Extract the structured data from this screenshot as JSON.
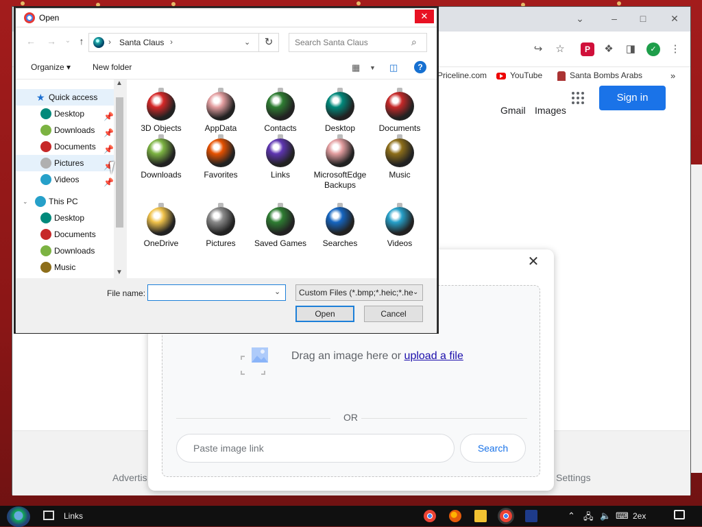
{
  "browser": {
    "bookmarks": [
      "Priceline.com",
      "YouTube",
      "Santa Bombs Arabs"
    ],
    "header_links": [
      "Gmail",
      "Images"
    ],
    "signin_label": "Sign in",
    "footer": {
      "left": "Advertis",
      "right": "Settings"
    }
  },
  "image_search": {
    "drop_text": "Drag an image here or",
    "upload_link": "upload a file",
    "or_label": "OR",
    "paste_placeholder": "Paste image link",
    "search_label": "Search"
  },
  "open_dialog": {
    "title": "Open",
    "breadcrumb": "Santa Claus",
    "search_placeholder": "Search Santa Claus",
    "organize_label": "Organize ▾",
    "new_folder_label": "New folder",
    "nav_pane": {
      "quick_access": "Quick access",
      "quick_items": [
        "Desktop",
        "Downloads",
        "Documents",
        "Pictures",
        "Videos"
      ],
      "this_pc": "This PC",
      "pc_items": [
        "Desktop",
        "Documents",
        "Downloads",
        "Music"
      ]
    },
    "files": [
      {
        "name": "3D Objects",
        "color": "#d62828"
      },
      {
        "name": "AppData",
        "color": "#e39ea0"
      },
      {
        "name": "Contacts",
        "color": "#2e7d32"
      },
      {
        "name": "Desktop",
        "color": "#00897b"
      },
      {
        "name": "Documents",
        "color": "#c62828"
      },
      {
        "name": "Downloads",
        "color": "#7cb342"
      },
      {
        "name": "Favorites",
        "color": "#e65100"
      },
      {
        "name": "Links",
        "color": "#5e35b1"
      },
      {
        "name": "MicrosoftEdgeBackups",
        "color": "#e39ea0"
      },
      {
        "name": "Music",
        "color": "#8d6e1a"
      },
      {
        "name": "OneDrive",
        "color": "#f0c24a"
      },
      {
        "name": "Pictures",
        "color": "#8a8a8a"
      },
      {
        "name": "Saved Games",
        "color": "#2e7d32"
      },
      {
        "name": "Searches",
        "color": "#1565c0"
      },
      {
        "name": "Videos",
        "color": "#26a0c9"
      }
    ],
    "file_name_label": "File name:",
    "file_name_value": "",
    "filter_value": "Custom Files (*.bmp;*.heic;*.he",
    "open_label": "Open",
    "cancel_label": "Cancel"
  },
  "taskbar": {
    "links_label": "Links",
    "clock": "2ex"
  },
  "icons": {
    "back": "back-arrow-icon",
    "forward": "forward-arrow-icon",
    "up": "up-arrow-icon",
    "refresh": "refresh-icon",
    "search": "search-icon",
    "help": "help-icon",
    "close": "close-icon"
  }
}
